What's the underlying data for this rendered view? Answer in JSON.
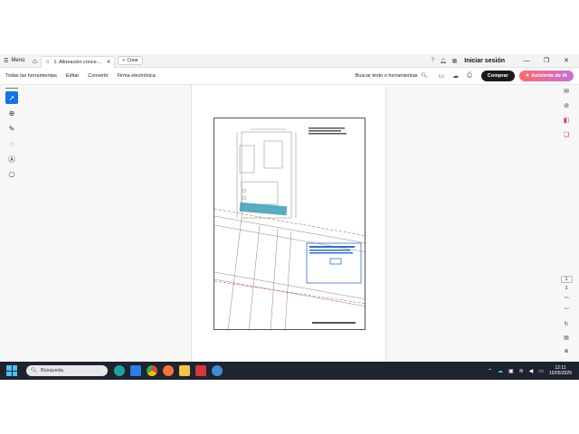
{
  "titlebar": {
    "menu_label": "Menú",
    "tab_title": "1. Alineación concesi...",
    "new_tab_label": "Crear",
    "signin_label": "Iniciar sesión"
  },
  "toolbar": {
    "items": [
      "Todas las herramientas",
      "Editar",
      "Convertir",
      "Firma electrónica"
    ],
    "search_label": "Buscar texto o herramientas",
    "buy_label": "Comprar",
    "ai_label": "Asistente de IA"
  },
  "pagenav": {
    "current_page": "1",
    "total_pages": "1"
  },
  "taskbar": {
    "search_placeholder": "Búsqueda",
    "time": "12:11",
    "date": "15/05/2025"
  },
  "colors": {
    "accent": "#1473e6",
    "taskbar": "#1d2430",
    "plan_highlight": "#3aa0b8",
    "plan_red": "#d83a3a",
    "plan_blue": "#2f6fd3"
  }
}
